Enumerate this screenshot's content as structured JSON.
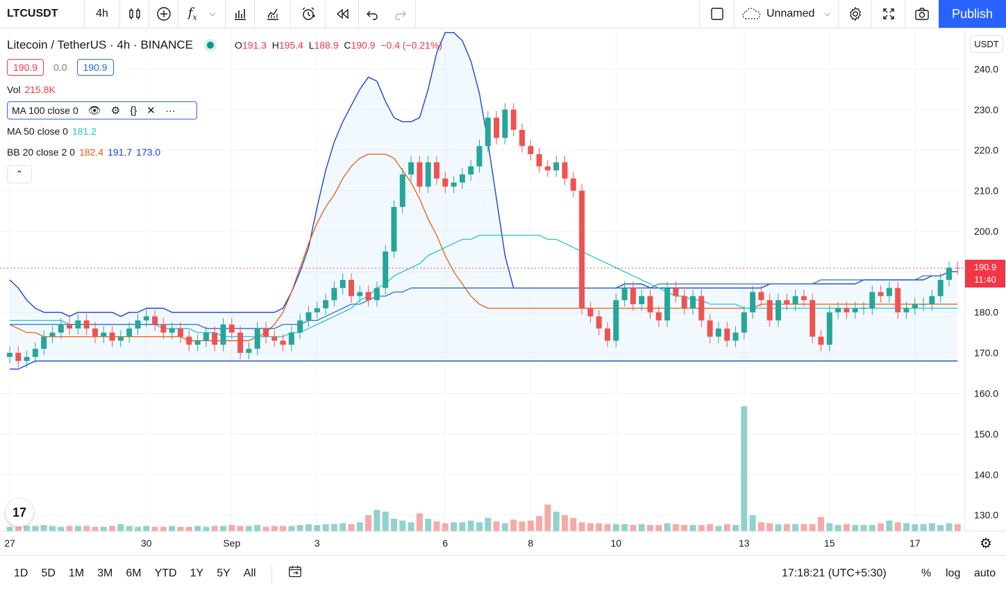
{
  "toolbar": {
    "symbol": "LTCUSDT",
    "interval": "4h",
    "layout_name": "Unnamed",
    "publish_label": "Publish"
  },
  "legend": {
    "title": "Litecoin / TetherUS · 4h · BINANCE",
    "o_label": "O",
    "o": "191.3",
    "h_label": "H",
    "h": "195.4",
    "l_label": "L",
    "l": "188.9",
    "c_label": "C",
    "c": "190.9",
    "change": "−0.4 (−0.21%)",
    "bid": "190.9",
    "spread": "0.0",
    "ask": "190.9",
    "vol_label": "Vol",
    "vol_value": "215.8K",
    "ma100_label": "MA 100 close 0",
    "ma50_label": "MA 50 close 0",
    "ma50_value": "181.2",
    "bb_label": "BB 20 close 2 0",
    "bb_basis": "182.4",
    "bb_upper": "191.7",
    "bb_lower": "173.0"
  },
  "price_axis": {
    "currency": "USDT",
    "last_price": "190.9",
    "countdown": "11:40"
  },
  "bottom": {
    "ranges": [
      "1D",
      "5D",
      "1M",
      "3M",
      "6M",
      "YTD",
      "1Y",
      "5Y",
      "All"
    ],
    "clock": "17:18:21 (UTC+5:30)",
    "percent": "%",
    "log": "log",
    "auto": "auto"
  },
  "colors": {
    "up": "#26a69a",
    "down": "#ef5350",
    "bb_band": "#1e3fd8",
    "bb_basis": "#f0560e",
    "ma50": "#22c3cf",
    "ma100": "#2a6ad6",
    "accent": "#2962ff"
  },
  "chart_data": {
    "type": "candlestick",
    "symbol": "LTCUSDT",
    "interval": "4h",
    "y_ticks": [
      130,
      140,
      150,
      160,
      170,
      180,
      190,
      200,
      210,
      220,
      230,
      240
    ],
    "ylim": [
      126,
      250
    ],
    "x_tick_labels": [
      {
        "label": "27",
        "bar": 0
      },
      {
        "label": "30",
        "bar": 16
      },
      {
        "label": "Sep",
        "bar": 26
      },
      {
        "label": "3",
        "bar": 36
      },
      {
        "label": "6",
        "bar": 51
      },
      {
        "label": "8",
        "bar": 61
      },
      {
        "label": "10",
        "bar": 71
      },
      {
        "label": "13",
        "bar": 86
      },
      {
        "label": "15",
        "bar": 96
      },
      {
        "label": "17",
        "bar": 106
      }
    ],
    "closes": [
      170,
      168,
      169,
      171,
      174,
      175,
      177,
      176,
      178,
      176,
      174,
      175,
      173,
      174,
      176,
      178,
      179,
      177,
      175,
      176,
      174,
      172,
      173,
      175,
      172,
      177,
      175,
      170,
      171,
      176,
      174,
      173,
      172,
      175,
      178,
      180,
      181,
      183,
      186,
      188,
      184,
      185,
      183,
      186,
      195,
      206,
      214,
      217,
      211,
      217,
      213,
      211,
      212,
      214,
      216,
      221,
      228,
      223,
      230,
      225,
      221,
      219,
      216,
      215,
      217,
      213,
      210,
      181,
      179,
      176,
      173,
      183,
      186,
      182,
      184,
      180,
      178,
      186,
      184,
      181,
      184,
      178,
      174,
      176,
      173,
      175,
      180,
      185,
      183,
      178,
      183,
      182,
      184,
      183,
      174,
      172,
      180,
      181,
      180,
      181,
      181,
      185,
      184,
      186,
      180,
      181,
      182,
      182,
      184,
      188,
      191,
      190.9
    ],
    "volumes": [
      5,
      5,
      6,
      6,
      7,
      6,
      5,
      6,
      6,
      6,
      5,
      5,
      6,
      8,
      6,
      5,
      6,
      5,
      5,
      6,
      5,
      5,
      6,
      5,
      6,
      6,
      7,
      6,
      6,
      7,
      5,
      6,
      6,
      6,
      7,
      8,
      7,
      8,
      8,
      9,
      8,
      10,
      18,
      24,
      22,
      14,
      12,
      10,
      20,
      14,
      11,
      9,
      10,
      10,
      12,
      10,
      15,
      11,
      9,
      13,
      11,
      12,
      17,
      30,
      22,
      18,
      15,
      10,
      9,
      9,
      8,
      8,
      8,
      7,
      8,
      7,
      7,
      9,
      8,
      7,
      7,
      7,
      8,
      6,
      8,
      7,
      140,
      18,
      10,
      9,
      8,
      8,
      8,
      8,
      8,
      16,
      9,
      7,
      8,
      7,
      7,
      7,
      9,
      12,
      10,
      9,
      8,
      8,
      9,
      7,
      9,
      8
    ],
    "bb_upper": [
      188,
      186,
      183,
      181,
      180,
      180,
      180,
      179,
      180,
      180,
      180,
      180,
      180,
      179,
      180,
      180,
      181,
      181,
      181,
      180,
      180,
      180,
      180,
      180,
      180,
      180,
      180,
      180,
      180,
      180,
      180,
      180,
      181,
      185,
      190,
      196,
      206,
      215,
      222,
      227,
      231,
      235,
      238,
      237,
      232,
      228,
      227,
      227,
      228,
      235,
      244,
      249,
      249,
      247,
      242,
      234,
      222,
      208,
      194,
      186,
      186,
      186,
      186,
      186,
      186,
      186,
      186,
      186,
      186,
      186,
      186,
      186,
      187,
      187,
      187,
      186,
      186,
      186,
      186,
      186,
      186,
      186,
      186,
      186,
      186,
      186,
      186,
      186,
      186,
      187,
      187,
      187,
      187,
      187,
      187,
      187,
      187,
      187,
      187,
      187,
      188,
      188,
      188,
      188,
      188,
      188,
      188,
      188,
      189,
      189,
      190,
      190
    ],
    "bb_basis": [
      177,
      176,
      175,
      175,
      174,
      174,
      174,
      174,
      174,
      174,
      174,
      174,
      174,
      174,
      174,
      174,
      174,
      174,
      174,
      174,
      174,
      173,
      173,
      173,
      173,
      173,
      173,
      173,
      173,
      174,
      175,
      177,
      180,
      185,
      191,
      197,
      202,
      206,
      209,
      213,
      216,
      218,
      219,
      219,
      219,
      218,
      215,
      212,
      208,
      203,
      199,
      194,
      190,
      187,
      184,
      182,
      181,
      181,
      181,
      181,
      181,
      181,
      181,
      181,
      181,
      181,
      181,
      181,
      181,
      181,
      181,
      181,
      181,
      181,
      181,
      181,
      181,
      181,
      181,
      181,
      181,
      181,
      181,
      181,
      181,
      181,
      181,
      181,
      182,
      182,
      182,
      182,
      182,
      182,
      182,
      182,
      182,
      182,
      182,
      182,
      182,
      182,
      182,
      182,
      182,
      182,
      182,
      182,
      182,
      182,
      182,
      182
    ],
    "bb_lower": [
      166,
      166,
      167,
      168,
      168,
      168,
      168,
      168,
      168,
      168,
      168,
      168,
      168,
      168,
      168,
      168,
      168,
      168,
      168,
      168,
      168,
      168,
      168,
      168,
      168,
      168,
      168,
      168,
      168,
      168,
      168,
      168,
      168,
      168,
      168,
      168,
      168,
      168,
      168,
      168,
      168,
      168,
      168,
      168,
      168,
      168,
      168,
      168,
      168,
      168,
      168,
      168,
      168,
      168,
      168,
      168,
      168,
      168,
      168,
      168,
      168,
      168,
      168,
      168,
      168,
      168,
      168,
      168,
      168,
      168,
      168,
      168,
      168,
      168,
      168,
      168,
      168,
      168,
      168,
      168,
      168,
      168,
      168,
      168,
      168,
      168,
      168,
      168,
      168,
      168,
      168,
      168,
      168,
      168,
      168,
      168,
      168,
      168,
      168,
      168,
      168,
      168,
      168,
      168,
      168,
      168,
      168,
      168,
      168,
      168,
      168,
      168
    ],
    "ma50": [
      178,
      178,
      178,
      178,
      178,
      178,
      178,
      177,
      177,
      177,
      177,
      177,
      177,
      177,
      177,
      177,
      177,
      177,
      176,
      176,
      176,
      176,
      175,
      175,
      175,
      174,
      174,
      174,
      174,
      174,
      174,
      174,
      174,
      175,
      175,
      176,
      177,
      178,
      179,
      180,
      181,
      183,
      184,
      186,
      187,
      189,
      190,
      191,
      192,
      194,
      195,
      196,
      197,
      198,
      198,
      199,
      199,
      199,
      199,
      199,
      199,
      199,
      199,
      198,
      198,
      197,
      196,
      195,
      194,
      193,
      192,
      191,
      190,
      189,
      188,
      187,
      186,
      185,
      184,
      184,
      183,
      183,
      182,
      182,
      182,
      182,
      181,
      181,
      181,
      181,
      181,
      181,
      181,
      181,
      181,
      181,
      181,
      181,
      181,
      181,
      181,
      181,
      181,
      181,
      181,
      181,
      181,
      181,
      181,
      181,
      181,
      181
    ],
    "ma100": [
      177,
      177,
      177,
      177,
      177,
      177,
      177,
      177,
      177,
      177,
      177,
      177,
      177,
      177,
      177,
      177,
      177,
      177,
      177,
      177,
      177,
      177,
      177,
      176,
      176,
      176,
      176,
      176,
      176,
      176,
      176,
      176,
      177,
      177,
      177,
      178,
      178,
      179,
      180,
      181,
      182,
      182,
      183,
      184,
      184,
      185,
      185,
      186,
      186,
      186,
      186,
      186,
      186,
      186,
      186,
      186,
      186,
      186,
      186,
      186,
      186,
      186,
      186,
      186,
      186,
      186,
      186,
      186,
      186,
      186,
      186,
      186,
      186,
      186,
      186,
      186,
      187,
      187,
      187,
      187,
      187,
      187,
      187,
      187,
      187,
      187,
      187,
      187,
      187,
      187,
      187,
      187,
      187,
      187,
      187,
      188,
      188,
      188,
      188,
      188,
      188,
      188,
      188,
      188,
      188,
      188,
      188,
      189,
      189,
      189,
      190,
      190
    ]
  }
}
